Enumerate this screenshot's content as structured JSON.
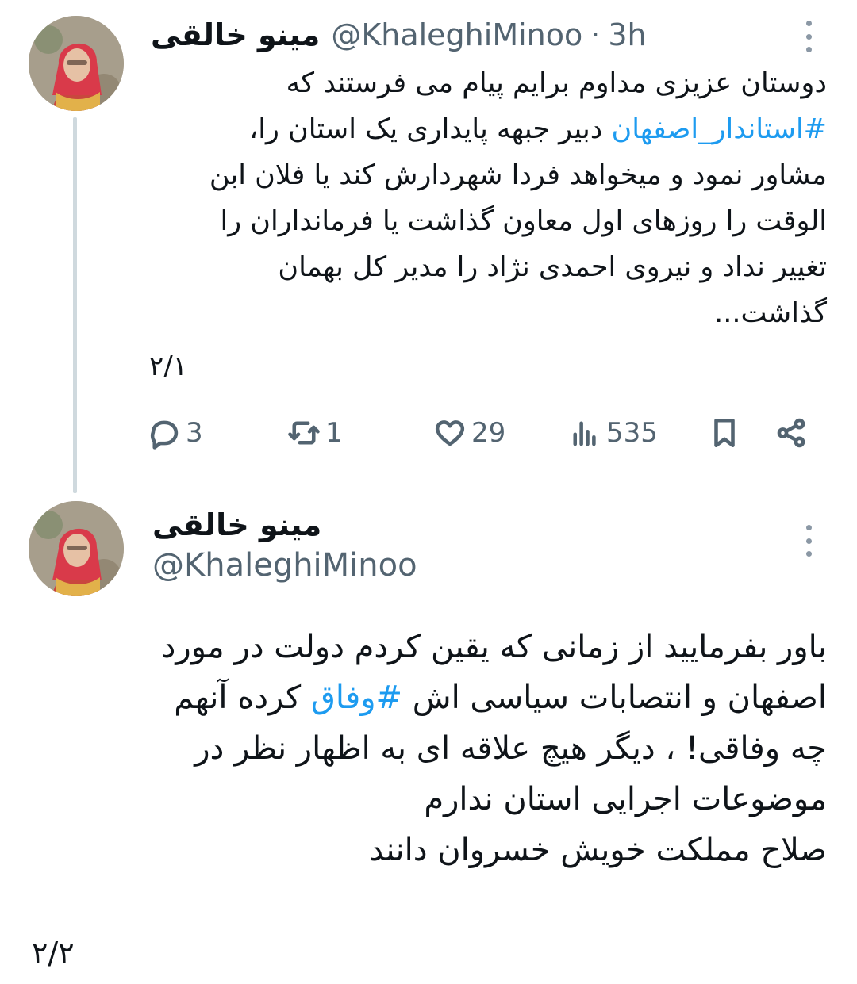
{
  "tweet1": {
    "author_name": "مینو خالقی",
    "handle": "@KhaleghiMinoo",
    "separator": "·",
    "time": "3h",
    "text_line1": "دوستان عزیزی مداوم برایم پیام می فرستند که",
    "hashtag": "#استاندار_اصفهان",
    "text_after_hashtag": " دبیر جبهه پایداری یک استان را،",
    "text_rest": "مشاور نمود و میخواهد فردا شهردارش کند یا فلان ابن\nالوقت را روزهای اول معاون گذاشت یا فرمانداران را\nتغییر نداد و نیروی احمدی نژاد را مدیر کل بهمان\nگذاشت...",
    "counter": "۲/۱",
    "actions": {
      "replies": "3",
      "retweets": "1",
      "likes": "29",
      "views": "535"
    }
  },
  "tweet2": {
    "author_name": "مینو خالقی",
    "handle": "@KhaleghiMinoo",
    "text_line1": "باور بفرمایید از زمانی که یقین کردم دولت در مورد\nاصفهان و انتصابات سیاسی اش ",
    "hashtag": "#وفاق",
    "text_after_hashtag": " کرده آنهم\nچه وفاقی! ، دیگر هیچ علاقه ای به اظهار نظر در\nموضوعات اجرایی استان ندارم\nصلاح مملکت خویش خسروان دانند",
    "counter": "۲/۲"
  },
  "icons": {
    "reply": "reply-icon",
    "retweet": "retweet-icon",
    "like": "heart-icon",
    "views": "views-icon",
    "bookmark": "bookmark-icon",
    "share": "share-icon",
    "more": "more-options-icon"
  },
  "colors": {
    "hashtag": "#1d9bf0",
    "secondary_text": "#536471",
    "thread_line": "#cfd9de"
  }
}
